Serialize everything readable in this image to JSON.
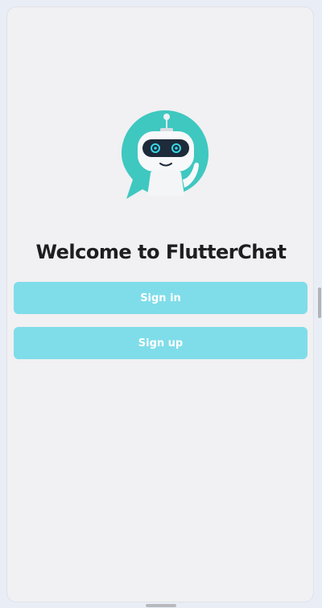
{
  "app": {
    "title": "Welcome to FlutterChat",
    "logo_icon": "chatbot-logo-icon"
  },
  "actions": {
    "signin_label": "Sign in",
    "signup_label": "Sign up"
  },
  "colors": {
    "accent": "#7fdde9",
    "logo_teal": "#3ec8c0",
    "background": "#f1f0f2",
    "title_text": "#1e1e22"
  }
}
